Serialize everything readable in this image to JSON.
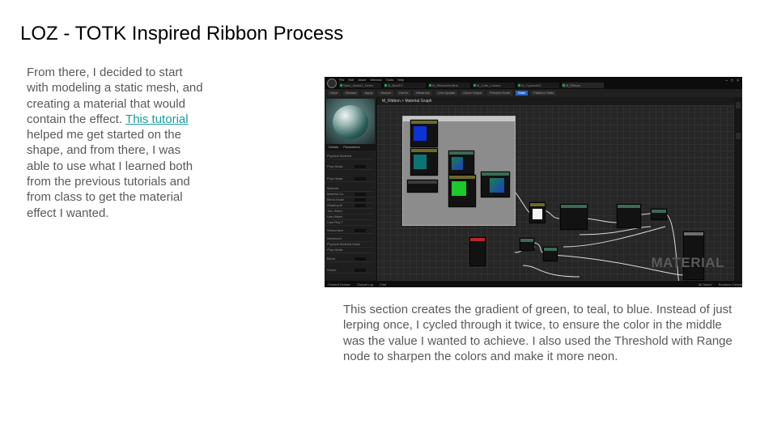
{
  "slide": {
    "title": "LOZ - TOTK Inspired Ribbon Process",
    "left_text": {
      "before_link": "From there, I decided to start with modeling a static mesh, and creating a material that would contain the effect. ",
      "link": "This tutorial",
      "after_link": " helped me get started on the shape, and from there, I was able to use what I learned both from the previous tutorials and from class to get the material effect I wanted."
    },
    "caption": "This section creates the gradient of green, to teal, to blue. Instead of just lerping once, I cycled through it twice, to ensure the color in the middle was the value I wanted to achieve. I also used the Threshold with Range node to sharpen the colors and make it more neon."
  },
  "editor": {
    "menu": [
      "File",
      "Edit",
      "Asset",
      "Window",
      "Tools",
      "Help"
    ],
    "tabs": [
      "Sand_Island1_Demo",
      "M_BlobFX",
      "M_RibbonRedline",
      "M_Cafe_Lnlorne",
      "M_Cyclone01",
      "M_Ribbon"
    ],
    "toolbar": [
      "Save",
      "Browse",
      "Apply",
      "Search",
      "Home",
      "Hierarchy",
      "Live Update",
      "Clean Graph",
      "Preview Node",
      "Stats",
      "Platform Stats"
    ],
    "details_tabs": [
      "Details",
      "Parameters"
    ],
    "properties": [
      "Physical Material",
      "Phys Mask",
      "Phys Mask",
      "Material",
      "Material Do",
      "Blend Mode",
      "Shading M",
      "Two Sided",
      "Use Materi",
      "Cast Ray T",
      "Subsurface",
      "Advanced",
      "Physical Material Mask",
      "Phys Mask",
      "Blend",
      "Shade"
    ],
    "graph_breadcrumb": "M_Ribbon > Material Graph",
    "status": [
      "Content Drawer",
      "Output Log",
      "Cmd"
    ],
    "status_right": [
      "All Saved",
      "Revision Control"
    ],
    "watermark": "MATERIAL",
    "swatch_colors": {
      "blue": "#0b33d6",
      "teal": "#0d7474",
      "green": "#1bcb2a",
      "gradient_start": "#1b7f4f",
      "gradient_end": "#1a3fc0",
      "white": "#f2f2f2"
    }
  }
}
